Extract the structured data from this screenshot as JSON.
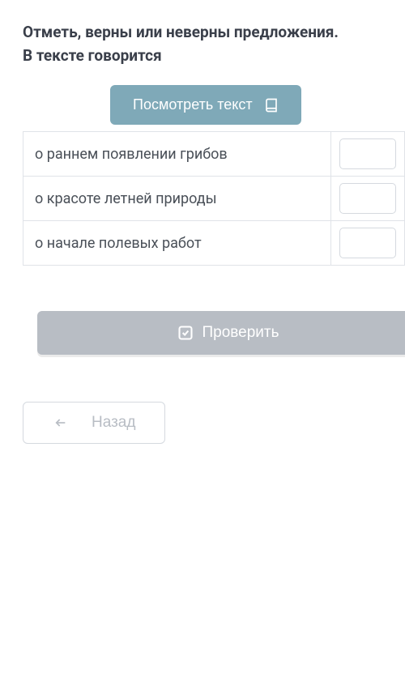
{
  "question": {
    "title": "Отметь, верны или неверны предложения.",
    "subtitle": "В тексте говорится"
  },
  "view_text_button": {
    "label": "Посмотреть текст"
  },
  "statements": [
    {
      "text": "о раннем появлении грибов"
    },
    {
      "text": "о красоте летней природы"
    },
    {
      "text": "о начале полевых работ"
    }
  ],
  "check_button": {
    "label": "Проверить"
  },
  "back_button": {
    "label": "Назад"
  }
}
